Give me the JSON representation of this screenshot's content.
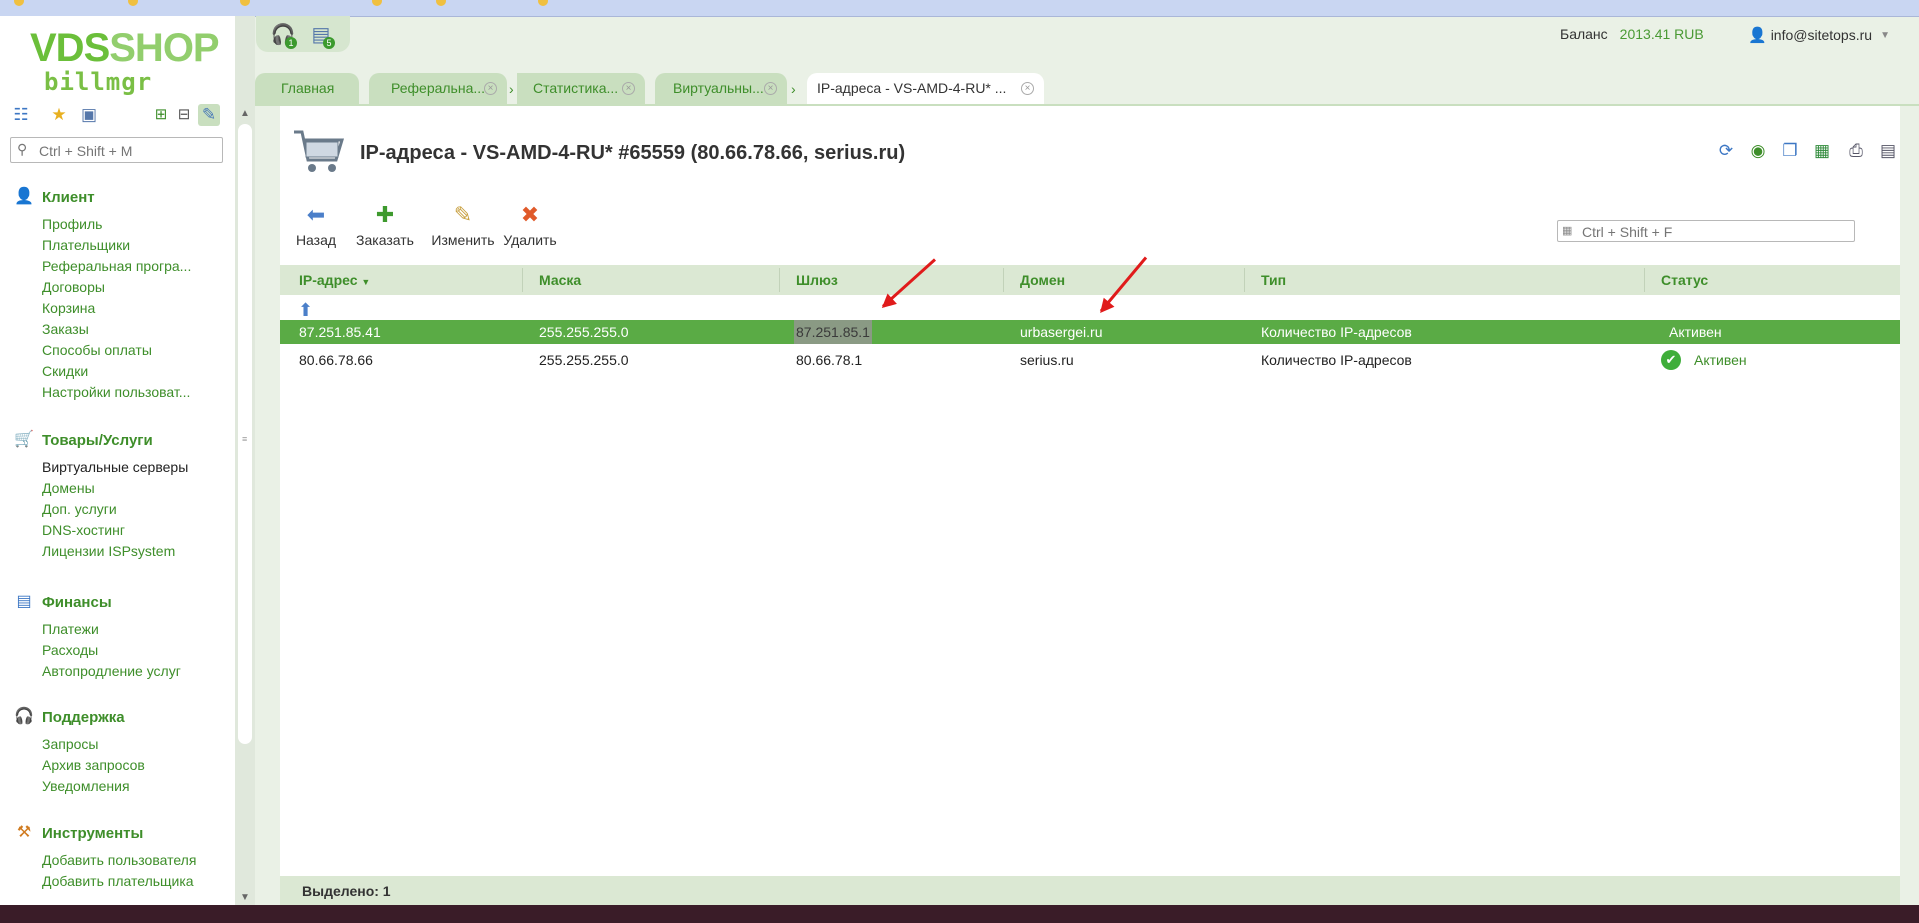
{
  "brand": {
    "logo_top_a": "VDS",
    "logo_top_b": "SHOP",
    "logo_bottom": "billmgr"
  },
  "sidebar": {
    "search_placeholder": "Ctrl + Shift + M",
    "sections": [
      {
        "title": "Клиент",
        "icon": "user-icon",
        "items": [
          "Профиль",
          "Плательщики",
          "Реферальная програ...",
          "Договоры",
          "Корзина",
          "Заказы",
          "Способы оплаты",
          "Скидки",
          "Настройки пользоват..."
        ]
      },
      {
        "title": "Товары/Услуги",
        "icon": "cart-icon",
        "items": [
          "Виртуальные серверы",
          "Домены",
          "Доп. услуги",
          "DNS-хостинг",
          "Лицензии ISPsystem"
        ]
      },
      {
        "title": "Финансы",
        "icon": "cash-register-icon",
        "items": [
          "Платежи",
          "Расходы",
          "Автопродление услуг"
        ]
      },
      {
        "title": "Поддержка",
        "icon": "headset-icon",
        "items": [
          "Запросы",
          "Архив запросов",
          "Уведомления"
        ]
      },
      {
        "title": "Инструменты",
        "icon": "tools-icon",
        "items": [
          "Добавить пользователя",
          "Добавить плательщика"
        ]
      }
    ]
  },
  "topbar": {
    "support_badge": "1",
    "notices_badge": "5",
    "balance_label": "Баланс",
    "balance_value": "2013.41 RUB",
    "user_email": "info@sitetops.ru"
  },
  "tabs": [
    "Главная",
    "Реферальна...",
    "Статистика...",
    "Виртуальны...",
    "IP-адреса - VS-AMD-4-RU* ..."
  ],
  "page": {
    "title": "IP-адреса - VS-AMD-4-RU* #65559 (80.66.78.66, serius.ru)",
    "actions": [
      "Назад",
      "Заказать",
      "Изменить",
      "Удалить"
    ],
    "table_search_placeholder": "Ctrl + Shift + F"
  },
  "table": {
    "columns": [
      "IP-адрес",
      "Маска",
      "Шлюз",
      "Домен",
      "Тип",
      "Статус"
    ],
    "rows": [
      {
        "ip": "87.251.85.41",
        "mask": "255.255.255.0",
        "gateway": "87.251.85.1",
        "domain": "urbasergei.ru",
        "type": "Количество IP-адресов",
        "status": "Активен"
      },
      {
        "ip": "80.66.78.66",
        "mask": "255.255.255.0",
        "gateway": "80.66.78.1",
        "domain": "serius.ru",
        "type": "Количество IP-адресов",
        "status": "Активен"
      }
    ]
  },
  "footer": {
    "selected": "Выделено: 1"
  },
  "colors": {
    "accent": "#3e8e2a",
    "selected_row": "#5aab45",
    "header_bg": "#dbe8d3",
    "annotation": "#e01b1b"
  }
}
